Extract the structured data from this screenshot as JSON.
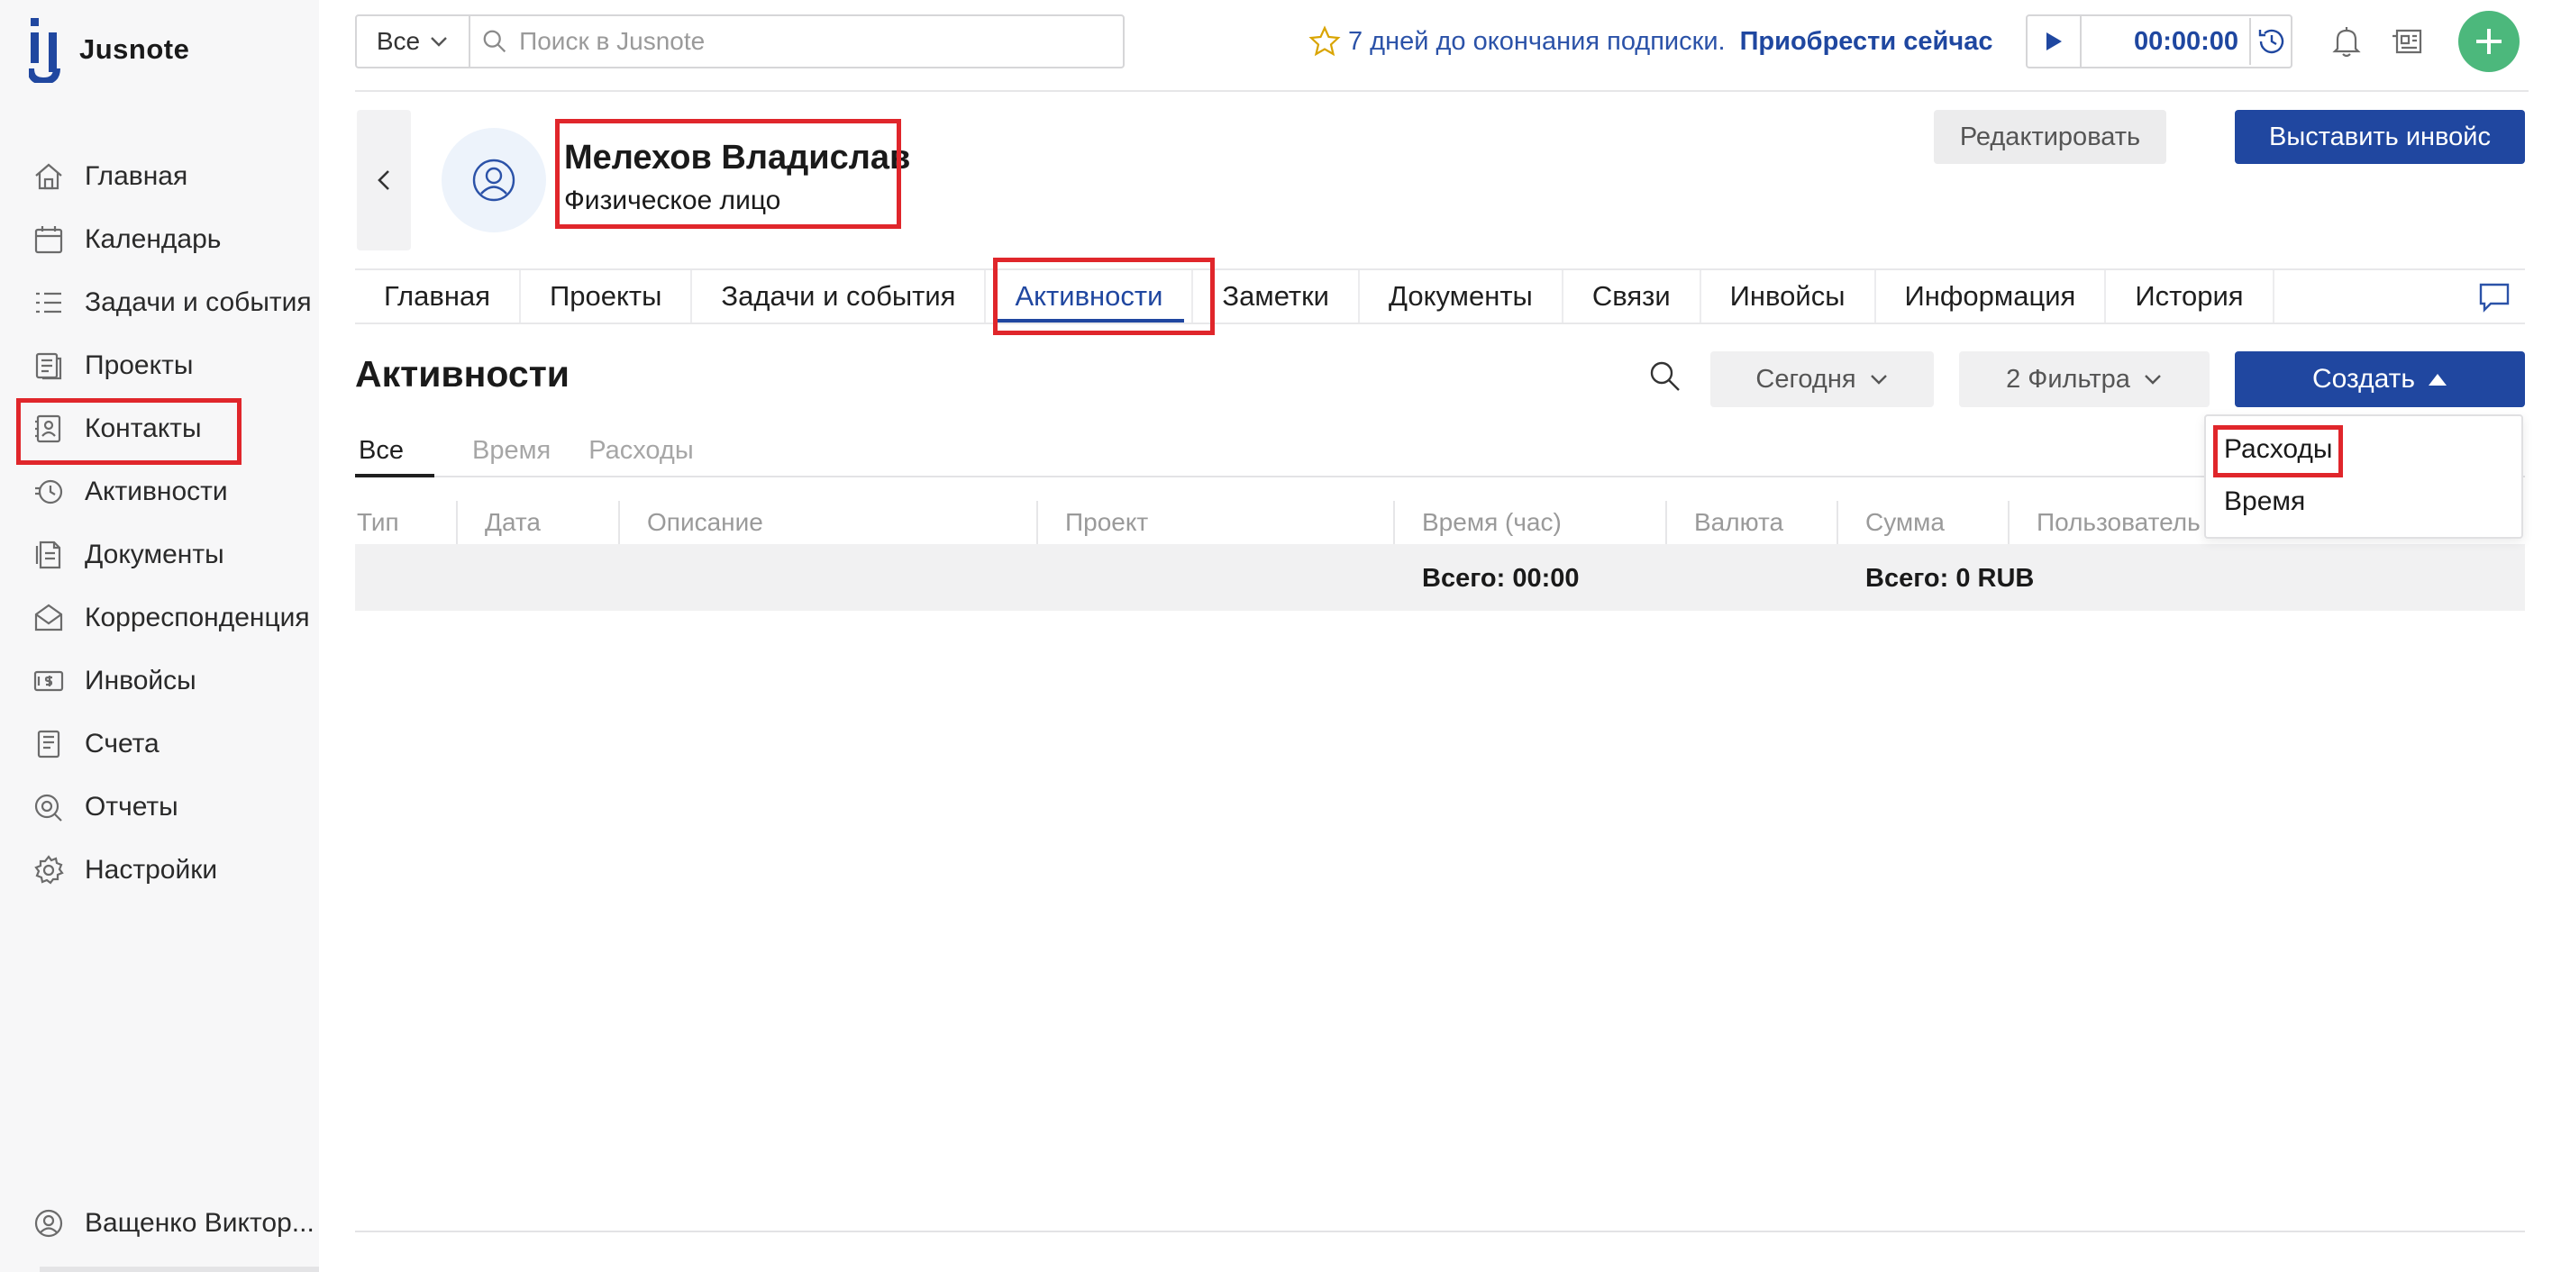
{
  "app": {
    "logo_text": "Jusnote"
  },
  "sidebar": {
    "items": [
      {
        "label": "Главная",
        "icon": "home-icon"
      },
      {
        "label": "Календарь",
        "icon": "calendar-icon"
      },
      {
        "label": "Задачи и события",
        "icon": "tasks-icon"
      },
      {
        "label": "Проекты",
        "icon": "projects-icon"
      },
      {
        "label": "Контакты",
        "icon": "contacts-icon",
        "active": true
      },
      {
        "label": "Активности",
        "icon": "activity-icon"
      },
      {
        "label": "Документы",
        "icon": "documents-icon"
      },
      {
        "label": "Корреспонденция",
        "icon": "mail-icon"
      },
      {
        "label": "Инвойсы",
        "icon": "invoice-icon"
      },
      {
        "label": "Счета",
        "icon": "accounts-icon"
      },
      {
        "label": "Отчеты",
        "icon": "reports-icon"
      },
      {
        "label": "Настройки",
        "icon": "gear-icon"
      }
    ],
    "user_name": "Ващенко Виктор..."
  },
  "topbar": {
    "scope_value": "Все",
    "search_placeholder": "Поиск в Jusnote",
    "subscription_text": "7 дней до окончания подписки.",
    "subscription_link": "Приобрести сейчас",
    "timer_value": "00:00:00"
  },
  "contact": {
    "name": "Мелехов Владислав",
    "type": "Физическое лицо",
    "edit_label": "Редактировать",
    "invoice_label": "Выставить инвойс"
  },
  "tabs": [
    {
      "label": "Главная"
    },
    {
      "label": "Проекты"
    },
    {
      "label": "Задачи и события"
    },
    {
      "label": "Активности",
      "active": true
    },
    {
      "label": "Заметки"
    },
    {
      "label": "Документы"
    },
    {
      "label": "Связи"
    },
    {
      "label": "Инвойсы"
    },
    {
      "label": "Информация"
    },
    {
      "label": "История"
    }
  ],
  "activities": {
    "title": "Активности",
    "period_label": "Сегодня",
    "filters_label": "2 Фильтра",
    "create_label": "Создать",
    "subtabs": [
      {
        "label": "Все",
        "active": true
      },
      {
        "label": "Время"
      },
      {
        "label": "Расходы"
      }
    ],
    "columns": [
      "Тип",
      "Дата",
      "Описание",
      "Проект",
      "Время (час)",
      "Валюта",
      "Сумма",
      "Пользователь"
    ],
    "total_time": "Всего: 00:00",
    "total_sum": "Всего: 0 RUB",
    "create_menu": [
      {
        "label": "Расходы"
      },
      {
        "label": "Время"
      }
    ]
  },
  "colors": {
    "accent": "#2047a0",
    "highlight": "#e0262b",
    "fab": "#4cb87c"
  }
}
